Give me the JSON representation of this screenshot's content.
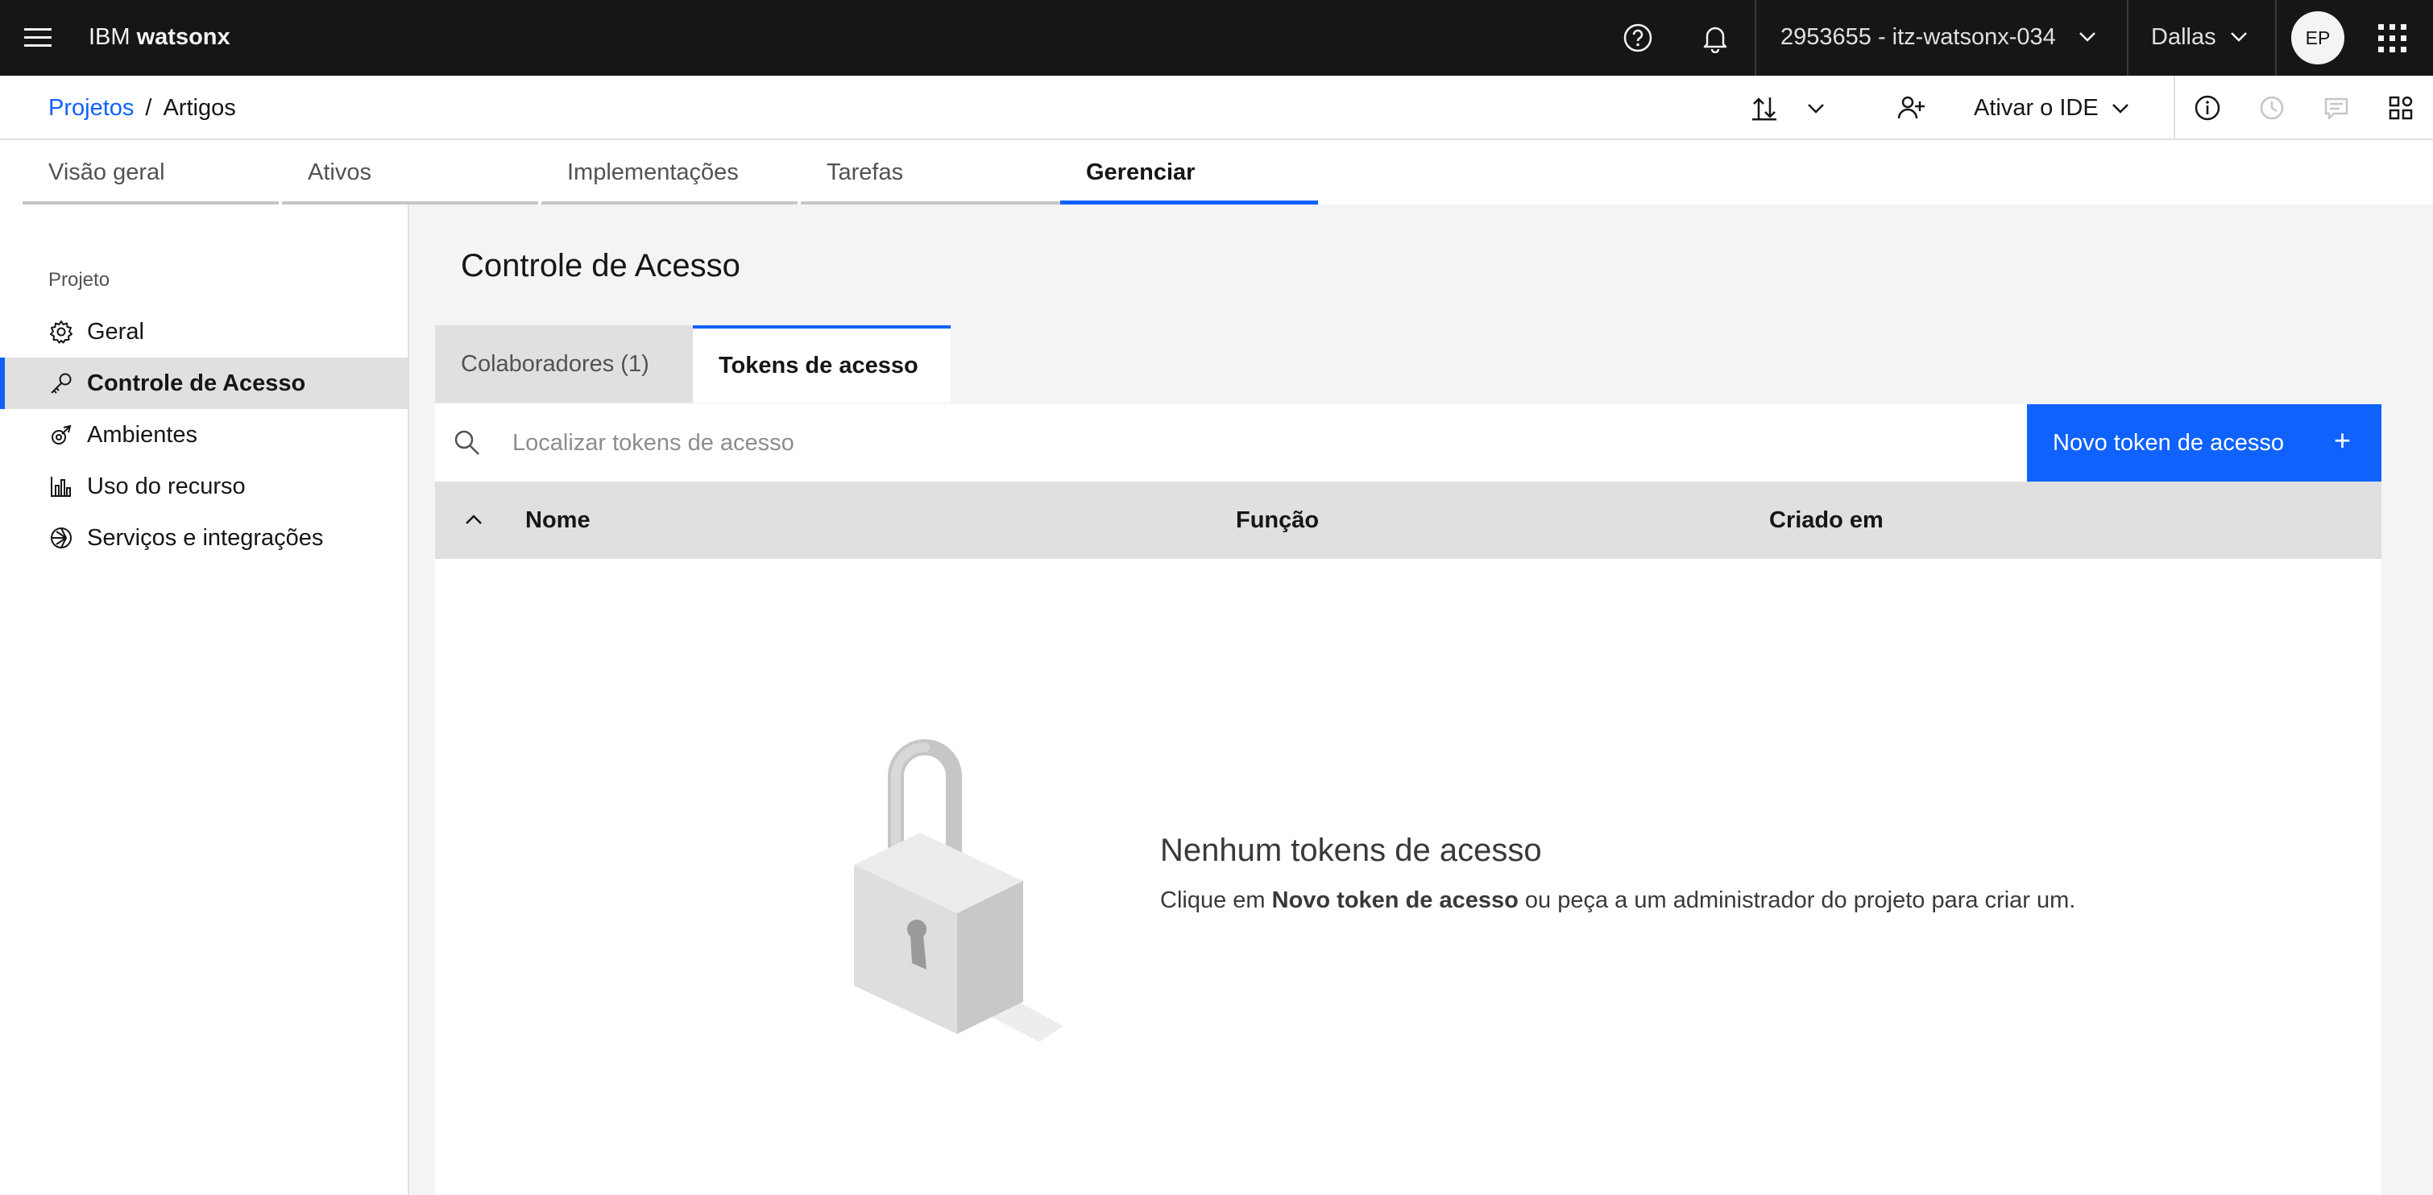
{
  "header": {
    "brand_prefix": "IBM",
    "brand_name": "watsonx",
    "account": "2953655 - itz-watsonx-034",
    "region": "Dallas",
    "avatar_initials": "EP"
  },
  "toolbar": {
    "breadcrumb_root": "Projetos",
    "breadcrumb_sep": "/",
    "breadcrumb_current": "Artigos",
    "ide_label": "Ativar o IDE"
  },
  "tabs": [
    {
      "label": "Visão geral"
    },
    {
      "label": "Ativos"
    },
    {
      "label": "Implementações"
    },
    {
      "label": "Tarefas"
    },
    {
      "label": "Gerenciar"
    }
  ],
  "sidebar": {
    "heading": "Projeto",
    "items": [
      {
        "label": "Geral",
        "icon": "gear-icon"
      },
      {
        "label": "Controle de Acesso",
        "icon": "key-icon"
      },
      {
        "label": "Ambientes",
        "icon": "environment-icon"
      },
      {
        "label": "Uso do recurso",
        "icon": "bar-chart-icon"
      },
      {
        "label": "Serviços e integrações",
        "icon": "integrations-icon"
      }
    ]
  },
  "main": {
    "title": "Controle de Acesso",
    "content_tabs": [
      {
        "label": "Colaboradores (1)"
      },
      {
        "label": "Tokens de acesso"
      }
    ],
    "search_placeholder": "Localizar tokens de acesso",
    "new_button_label": "Novo token de acesso",
    "new_button_icon": "+",
    "columns": [
      "Nome",
      "Função",
      "Criado em"
    ],
    "empty_title": "Nenhum tokens de acesso",
    "empty_text_before": "Clique em",
    "empty_text_bold": "Novo token de acesso",
    "empty_text_after": "ou peça a um administrador do projeto para criar um."
  },
  "colors": {
    "accent": "#0f62fe",
    "header_bg": "#161616",
    "page_bg": "#f4f4f4"
  }
}
